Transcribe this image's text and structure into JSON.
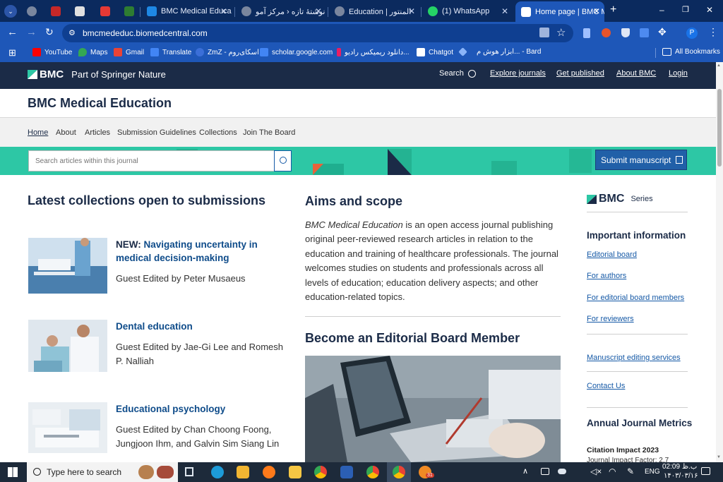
{
  "browser": {
    "tabs": [
      {
        "title": "",
        "active": false
      },
      {
        "title": "",
        "active": false
      },
      {
        "title": "",
        "active": false
      },
      {
        "title": "",
        "active": false
      },
      {
        "title": "",
        "active": false
      },
      {
        "title": "BMC Medical Educa",
        "active": false
      },
      {
        "title": "نوشتۀ تازه ‹ مرکز آمو",
        "active": false
      },
      {
        "title": "Education | المنتور",
        "active": false
      },
      {
        "title": "(1) WhatsApp",
        "active": false
      },
      {
        "title": "Home page | BMC M",
        "active": true
      }
    ],
    "new_tab": "+",
    "window_controls": {
      "minimize": "–",
      "restore": "❐",
      "close": "✕"
    },
    "url": "bmcmededuc.biomedcentral.com",
    "profile_initial": "P",
    "bookmarks": [
      {
        "label": "YouTube",
        "icon": "youtube-icon",
        "color": "#ff0000"
      },
      {
        "label": "Maps",
        "icon": "maps-icon",
        "color": "#34a853"
      },
      {
        "label": "Gmail",
        "icon": "gmail-icon",
        "color": "#ea4335"
      },
      {
        "label": "Translate",
        "icon": "translate-icon",
        "color": "#4285f4"
      },
      {
        "label": "ZmZ - اسکای‌روم",
        "icon": "zmz-icon",
        "color": "#3b6fd8"
      },
      {
        "label": "scholar.google.com",
        "icon": "scholar-icon",
        "color": "#4285f4"
      },
      {
        "label": "دانلود ریمیکس رادیو...",
        "icon": "music-icon",
        "color": "#e91e63"
      },
      {
        "label": "Chatgot",
        "icon": "chatgot-icon",
        "color": "#ffffff"
      },
      {
        "label": "ابزار هوش م... - Bard",
        "icon": "bard-icon",
        "color": "#8ab4f8"
      }
    ],
    "all_bookmarks": "All Bookmarks"
  },
  "site": {
    "brand": "BMC",
    "brand_tagline": "Part of Springer Nature",
    "search_label": "Search",
    "top_nav": [
      "Explore journals",
      "Get published",
      "About BMC",
      "Login"
    ],
    "journal_title": "BMC Medical Education",
    "sub_nav": [
      "Home",
      "About",
      "Articles",
      "Submission Guidelines",
      "Collections",
      "Join The Board"
    ],
    "search_placeholder": "Search articles within this journal",
    "submit_button": "Submit manuscript",
    "accent_color": "#2dc7a5",
    "navy_color": "#1b2b47"
  },
  "collections": {
    "heading": "Latest collections open to submissions",
    "items": [
      {
        "prefix": "NEW: ",
        "title": "Navigating uncertainty in medical decision-making",
        "editors": "Guest Edited by Peter Musaeus"
      },
      {
        "prefix": "",
        "title": "Dental education",
        "editors": "Guest Edited by Jae-Gi Lee and Romesh P. Nalliah"
      },
      {
        "prefix": "",
        "title": "Educational psychology",
        "editors": "Guest Edited by Chan Choong Foong, Jungjoon Ihm, and Galvin Sim Siang Lin"
      }
    ]
  },
  "aims": {
    "heading": "Aims and scope",
    "journal_name": "BMC Medical Education",
    "text": " is an open access journal publishing original peer-reviewed research articles in relation to the education and training of healthcare professionals. The journal welcomes studies on students and professionals across all levels of education; education delivery aspects; and other education-related topics."
  },
  "editorial": {
    "heading": "Become an Editorial Board Member"
  },
  "sidebar": {
    "brand": "BMC",
    "series": "Series",
    "important_heading": "Important information",
    "links": [
      "Editorial board",
      "For authors",
      "For editorial board members",
      "For reviewers"
    ],
    "services_link": "Manuscript editing services",
    "contact_link": "Contact Us",
    "metrics_heading": "Annual Journal Metrics",
    "citation_heading": "Citation Impact 2023",
    "citation_line": "Journal Impact Factor: 2.7"
  },
  "taskbar": {
    "search_placeholder": "Type here to search",
    "language": "ENG",
    "time": "02:09 ب.ظ",
    "date": "۱۴۰۳/۰۳/۱۶",
    "badge_count": "31"
  }
}
